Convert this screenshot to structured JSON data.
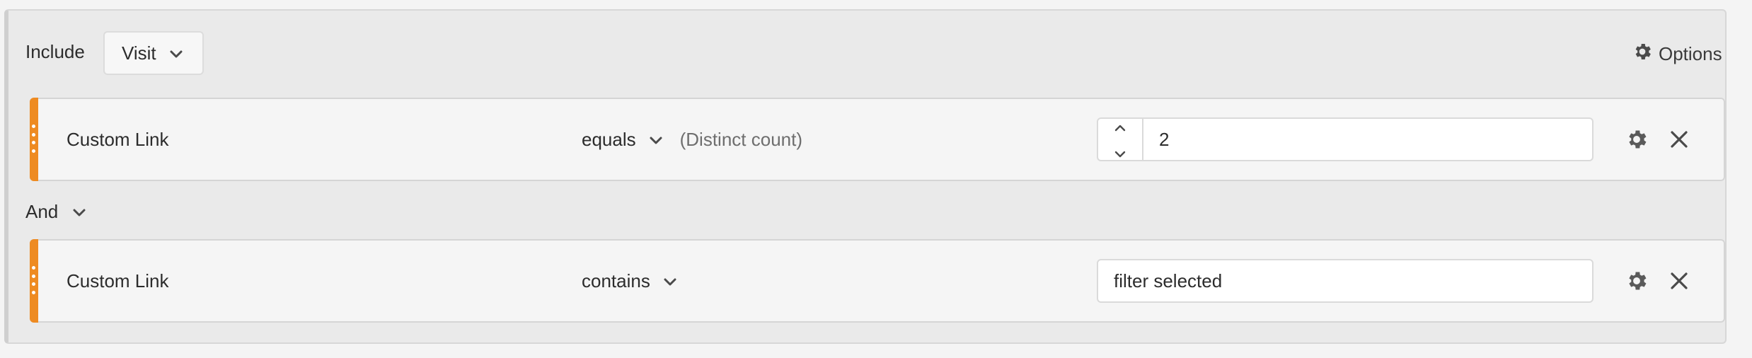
{
  "header": {
    "include_label": "Include",
    "container_type": "Visit",
    "options_label": "Options"
  },
  "rules": [
    {
      "dimension": "Custom Link",
      "operator": "equals",
      "operator_hint": "(Distinct count)",
      "value": "2",
      "has_stepper": true
    },
    {
      "dimension": "Custom Link",
      "operator": "contains",
      "operator_hint": "",
      "value": "filter selected",
      "has_stepper": false
    }
  ],
  "connector": {
    "label": "And"
  },
  "colors": {
    "handle": "#ee8b22",
    "container_bg": "#eaeaea",
    "row_bg": "#f5f5f5"
  },
  "icons": {
    "options": "gear-icon",
    "row_settings": "gear-icon",
    "row_remove": "close-icon",
    "dropdown": "chevron-down-icon"
  }
}
